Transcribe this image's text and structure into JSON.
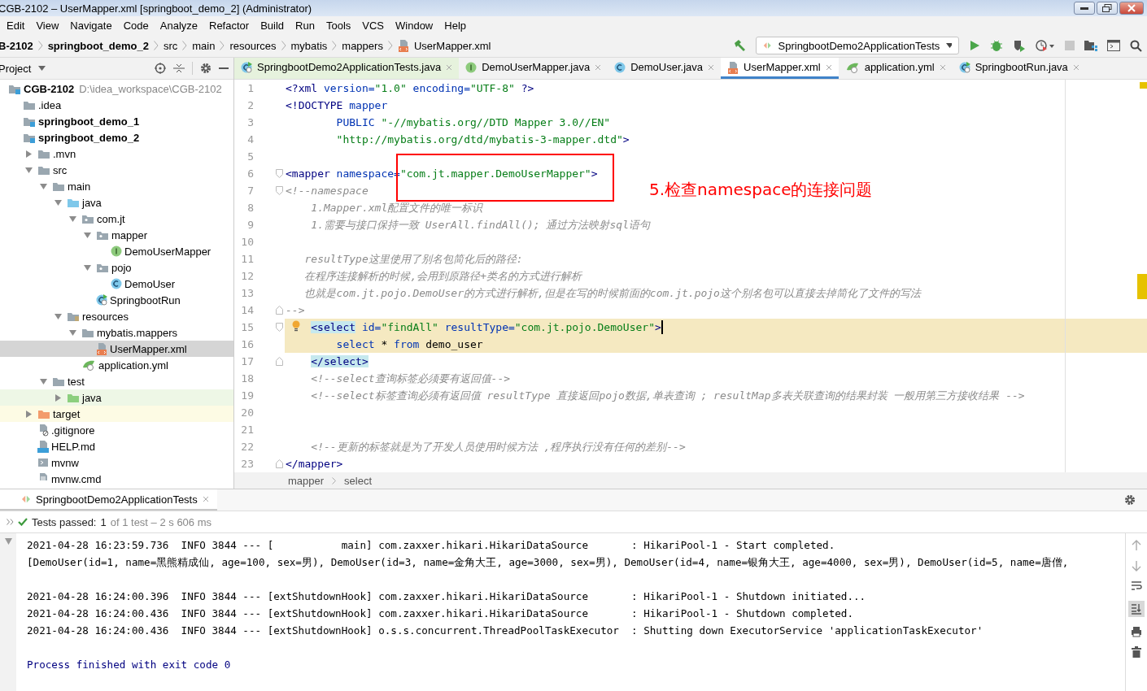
{
  "window": {
    "title": "CGB-2102 – UserMapper.xml [springboot_demo_2] (Administrator)"
  },
  "menu": [
    "Edit",
    "View",
    "Navigate",
    "Code",
    "Analyze",
    "Refactor",
    "Build",
    "Run",
    "Tools",
    "VCS",
    "Window",
    "Help"
  ],
  "breadcrumb": [
    {
      "label": "B-2102",
      "bold": true,
      "kind": "plain"
    },
    {
      "label": "springboot_demo_2",
      "bold": true,
      "kind": "plain"
    },
    {
      "label": "src",
      "bold": false,
      "kind": "plain"
    },
    {
      "label": "main",
      "bold": false,
      "kind": "plain"
    },
    {
      "label": "resources",
      "bold": false,
      "kind": "plain"
    },
    {
      "label": "mybatis",
      "bold": false,
      "kind": "plain"
    },
    {
      "label": "mappers",
      "bold": false,
      "kind": "plain"
    },
    {
      "label": "UserMapper.xml",
      "bold": false,
      "kind": "xml"
    }
  ],
  "run_config": {
    "label": "SpringbootDemo2ApplicationTests"
  },
  "project_panel": {
    "title": "Project"
  },
  "tree": [
    {
      "label": "CGB-2102",
      "hint": "D:\\idea_workspace\\CGB-2102",
      "bold": true,
      "kind": "module",
      "selected": false,
      "children": [
        {
          "label": ".idea",
          "bold": false,
          "kind": "folder",
          "selected": false
        },
        {
          "label": "springboot_demo_1",
          "bold": true,
          "kind": "module",
          "selected": false
        },
        {
          "label": "springboot_demo_2",
          "bold": true,
          "kind": "module",
          "selected": false,
          "children": [
            {
              "label": ".mvn",
              "bold": false,
              "kind": "folder",
              "selected": false,
              "expanded": false
            },
            {
              "label": "src",
              "bold": false,
              "kind": "folder",
              "selected": false,
              "expanded": true,
              "children": [
                {
                  "label": "main",
                  "bold": false,
                  "kind": "folder",
                  "selected": false,
                  "expanded": true,
                  "children": [
                    {
                      "label": "java",
                      "bold": false,
                      "kind": "source",
                      "selected": false,
                      "expanded": true,
                      "children": [
                        {
                          "label": "com.jt",
                          "bold": false,
                          "kind": "package",
                          "selected": false,
                          "expanded": true,
                          "children": [
                            {
                              "label": "mapper",
                              "bold": false,
                              "kind": "package",
                              "selected": false,
                              "expanded": true,
                              "children": [
                                {
                                  "label": "DemoUserMapper",
                                  "bold": false,
                                  "kind": "interface",
                                  "selected": false
                                }
                              ]
                            },
                            {
                              "label": "pojo",
                              "bold": false,
                              "kind": "package",
                              "selected": false,
                              "expanded": true,
                              "children": [
                                {
                                  "label": "DemoUser",
                                  "bold": false,
                                  "kind": "class",
                                  "selected": false
                                }
                              ]
                            },
                            {
                              "label": "SpringbootRun",
                              "bold": false,
                              "kind": "boot",
                              "selected": false
                            }
                          ]
                        }
                      ]
                    },
                    {
                      "label": "resources",
                      "bold": false,
                      "kind": "resources",
                      "selected": false,
                      "expanded": true,
                      "children": [
                        {
                          "label": "mybatis.mappers",
                          "bold": false,
                          "kind": "folder",
                          "selected": false,
                          "expanded": true,
                          "children": [
                            {
                              "label": "UserMapper.xml",
                              "bold": false,
                              "kind": "xml",
                              "selected": true
                            }
                          ]
                        },
                        {
                          "label": "application.yml",
                          "bold": false,
                          "kind": "yml",
                          "selected": false
                        }
                      ]
                    }
                  ]
                },
                {
                  "label": "test",
                  "bold": false,
                  "kind": "folder",
                  "selected": false,
                  "expanded": true,
                  "children": [
                    {
                      "label": "java",
                      "bold": false,
                      "kind": "test",
                      "selected": false,
                      "expanded": false
                    }
                  ]
                }
              ]
            },
            {
              "label": "target",
              "bold": false,
              "kind": "excluded",
              "selected": false,
              "expanded": false
            },
            {
              "label": ".gitignore",
              "bold": false,
              "kind": "ignore",
              "selected": false
            },
            {
              "label": "HELP.md",
              "bold": false,
              "kind": "md",
              "selected": false
            },
            {
              "label": "mvnw",
              "bold": false,
              "kind": "script",
              "selected": false
            },
            {
              "label": "mvnw.cmd",
              "bold": false,
              "kind": "text",
              "selected": false
            }
          ]
        }
      ]
    }
  ],
  "tabs": [
    {
      "label": "SpringbootDemo2ApplicationTests.java",
      "kind": "test",
      "selected": false
    },
    {
      "label": "DemoUserMapper.java",
      "kind": "interface",
      "selected": false
    },
    {
      "label": "DemoUser.java",
      "kind": "class",
      "selected": false
    },
    {
      "label": "UserMapper.xml",
      "kind": "xml",
      "selected": true
    },
    {
      "label": "application.yml",
      "kind": "yml",
      "selected": false
    },
    {
      "label": "SpringbootRun.java",
      "kind": "boot",
      "selected": false
    }
  ],
  "code": [
    {
      "number": "1",
      "tokens": [
        {
          "text": "<?xml",
          "kind": "tag"
        },
        {
          "text": " version=",
          "kind": "attr"
        },
        {
          "text": "\"1.0\"",
          "kind": "value"
        },
        {
          "text": " encoding=",
          "kind": "attr"
        },
        {
          "text": "\"UTF-8\"",
          "kind": "value"
        },
        {
          "text": " ?>",
          "kind": "tag"
        }
      ]
    },
    {
      "number": "2",
      "tokens": [
        {
          "text": "<!DOCTYPE",
          "kind": "tag"
        },
        {
          "text": " mapper",
          "kind": "attr"
        }
      ]
    },
    {
      "number": "3",
      "tokens": [
        {
          "text": "        PUBLIC ",
          "kind": "attr"
        },
        {
          "text": "\"-//mybatis.org//DTD Mapper 3.0//EN\"",
          "kind": "value"
        }
      ]
    },
    {
      "number": "4",
      "tokens": [
        {
          "text": "        \"http://mybatis.org/dtd/mybatis-3-mapper.dtd\"",
          "kind": "value"
        },
        {
          "text": ">",
          "kind": "tag"
        }
      ]
    },
    {
      "number": "5"
    },
    {
      "number": "6",
      "fold_start": true,
      "tokens": [
        {
          "text": "<mapper",
          "kind": "tag"
        },
        {
          "text": " namespace=",
          "kind": "attr"
        },
        {
          "text": "\"com.jt.mapper.DemoUserMapper\"",
          "kind": "value"
        },
        {
          "text": ">",
          "kind": "tag"
        }
      ]
    },
    {
      "number": "7",
      "fold_start": true,
      "tokens": [
        {
          "text": "<!--namespace",
          "kind": "comment"
        }
      ]
    },
    {
      "number": "8",
      "tokens": [
        {
          "text": "    1.Mapper.xml配置文件的唯一标识",
          "kind": "comment"
        }
      ]
    },
    {
      "number": "9",
      "tokens": [
        {
          "text": "    1.需要与接口保持一致 UserAll.findAll(); 通过方法映射sql语句",
          "kind": "comment"
        }
      ]
    },
    {
      "number": "10"
    },
    {
      "number": "11",
      "tokens": [
        {
          "text": "   resultType这里使用了别名包简化后的路径:",
          "kind": "comment"
        }
      ]
    },
    {
      "number": "12",
      "tokens": [
        {
          "text": "   在程序连接解析的时候,会用到原路径+类名的方式进行解析",
          "kind": "comment"
        }
      ]
    },
    {
      "number": "13",
      "tokens": [
        {
          "text": "   也就是com.jt.pojo.DemoUser的方式进行解析,但是在写的时候前面的com.jt.pojo这个别名包可以直接去掉简化了文件的写法",
          "kind": "comment"
        }
      ]
    },
    {
      "number": "14",
      "fold_end": true,
      "tokens": [
        {
          "text": "-->",
          "kind": "comment"
        }
      ]
    },
    {
      "number": "15",
      "fold_start": true,
      "indented": true,
      "highlighted": true,
      "bulb": true,
      "caret": true,
      "tokens": [
        {
          "text": "<select",
          "kind": "tag",
          "matched": true
        },
        {
          "text": " id=",
          "kind": "attr"
        },
        {
          "text": "\"findAll\"",
          "kind": "value"
        },
        {
          "text": " resultType=",
          "kind": "attr"
        },
        {
          "text": "\"com.jt.pojo.DemoUser\"",
          "kind": "value"
        },
        {
          "text": ">",
          "kind": "tag"
        }
      ]
    },
    {
      "number": "16",
      "highlighted": true,
      "tokens": [
        {
          "text": "        select",
          "kind": "attr"
        },
        {
          "text": " * ",
          "kind": "text"
        },
        {
          "text": "from",
          "kind": "attr"
        },
        {
          "text": " demo_user",
          "kind": "text"
        }
      ]
    },
    {
      "number": "17",
      "fold_end": true,
      "indented": true,
      "tokens": [
        {
          "text": "</select>",
          "kind": "tag",
          "matched": true
        }
      ]
    },
    {
      "number": "18",
      "tokens": [
        {
          "text": "    <!--select查询标签必须要有返回值-->",
          "kind": "comment"
        }
      ]
    },
    {
      "number": "19",
      "tokens": [
        {
          "text": "    <!--select标签查询必须有返回值 resultType 直接返回pojo数据,单表查询 ; resultMap多表关联查询的结果封装 一般用第三方接收结果 -->",
          "kind": "comment"
        }
      ]
    },
    {
      "number": "20"
    },
    {
      "number": "21"
    },
    {
      "number": "22",
      "tokens": [
        {
          "text": "    <!--更新的标签就是为了开发人员使用时候方法 ,程序执行没有任何的差别-->",
          "kind": "comment"
        }
      ]
    },
    {
      "number": "23",
      "fold_end": true,
      "tokens": [
        {
          "text": "</mapper>",
          "kind": "tag"
        }
      ]
    }
  ],
  "annotation": {
    "text": "5.检查namespace的连接问题"
  },
  "editor_breadcrumb": [
    "mapper",
    "select"
  ],
  "run_panel": {
    "tab": "SpringbootDemo2ApplicationTests",
    "status": {
      "label": "Tests passed:",
      "count": "1",
      "detail": "of 1 test – 2 s 606 ms"
    },
    "console": [
      [
        "2021-04-28 16:23:59.736  INFO 3844 --- [           main] com.zaxxer.hikari.HikariDataSource       : HikariPool-1 - Start completed.",
        "[DemoUser(id=1, name=黑熊精成仙, age=100, sex=男), DemoUser(id=3, name=金角大王, age=3000, sex=男), DemoUser(id=4, name=银角大王, age=4000, sex=男), DemoUser(id=5, name=唐僧,"
      ],
      [
        "2021-04-28 16:24:00.396  INFO 3844 --- [extShutdownHook] com.zaxxer.hikari.HikariDataSource       : HikariPool-1 - Shutdown initiated...",
        "2021-04-28 16:24:00.436  INFO 3844 --- [extShutdownHook] com.zaxxer.hikari.HikariDataSource       : HikariPool-1 - Shutdown completed.",
        "2021-04-28 16:24:00.436  INFO 3844 --- [extShutdownHook] o.s.s.concurrent.ThreadPoolTaskExecutor  : Shutting down ExecutorService 'applicationTaskExecutor'"
      ]
    ],
    "exit_line": "Process finished with exit code 0"
  }
}
